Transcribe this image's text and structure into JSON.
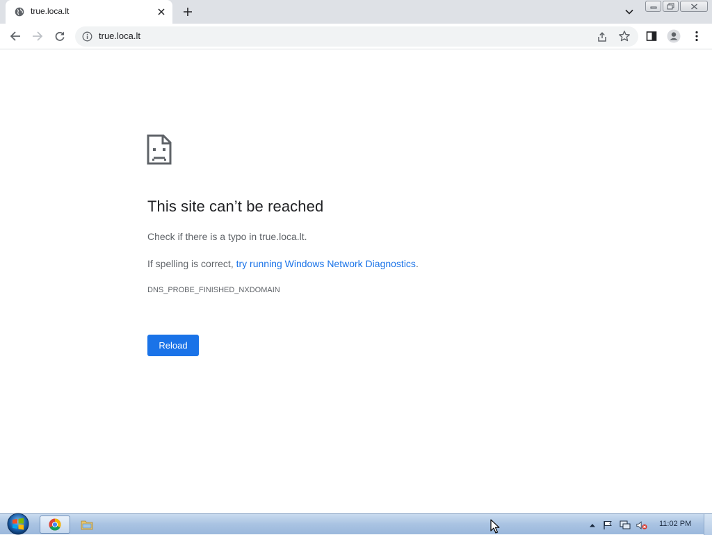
{
  "browser": {
    "tab": {
      "title": "true.loca.lt"
    },
    "omnibox": {
      "url": "true.loca.lt"
    }
  },
  "error_page": {
    "title": "This site can’t be reached",
    "line1": "Check if there is a typo in true.loca.lt.",
    "line2_prefix": "If spelling is correct, ",
    "line2_link": "try running Windows Network Diagnostics",
    "line2_suffix": ".",
    "error_code": "DNS_PROBE_FINISHED_NXDOMAIN",
    "reload_label": "Reload"
  },
  "taskbar": {
    "clock": "11:02 PM"
  },
  "icons": {
    "tab_favicon": "globe-icon",
    "tab_close": "close-icon",
    "new_tab": "plus-icon",
    "tab_search": "chevron-down-icon",
    "back": "arrow-left-icon",
    "forward": "arrow-right-icon",
    "reload": "reload-icon",
    "site_info": "info-icon",
    "share": "share-icon",
    "bookmark": "star-icon",
    "side_panel": "side-panel-icon",
    "profile": "person-icon",
    "menu": "kebab-menu-icon",
    "sad_page": "sad-page-icon"
  },
  "colors": {
    "link": "#1a73e8",
    "button": "#1a73e8",
    "title_text": "#202124",
    "body_text": "#5f6368",
    "tabstrip": "#dee1e6"
  }
}
